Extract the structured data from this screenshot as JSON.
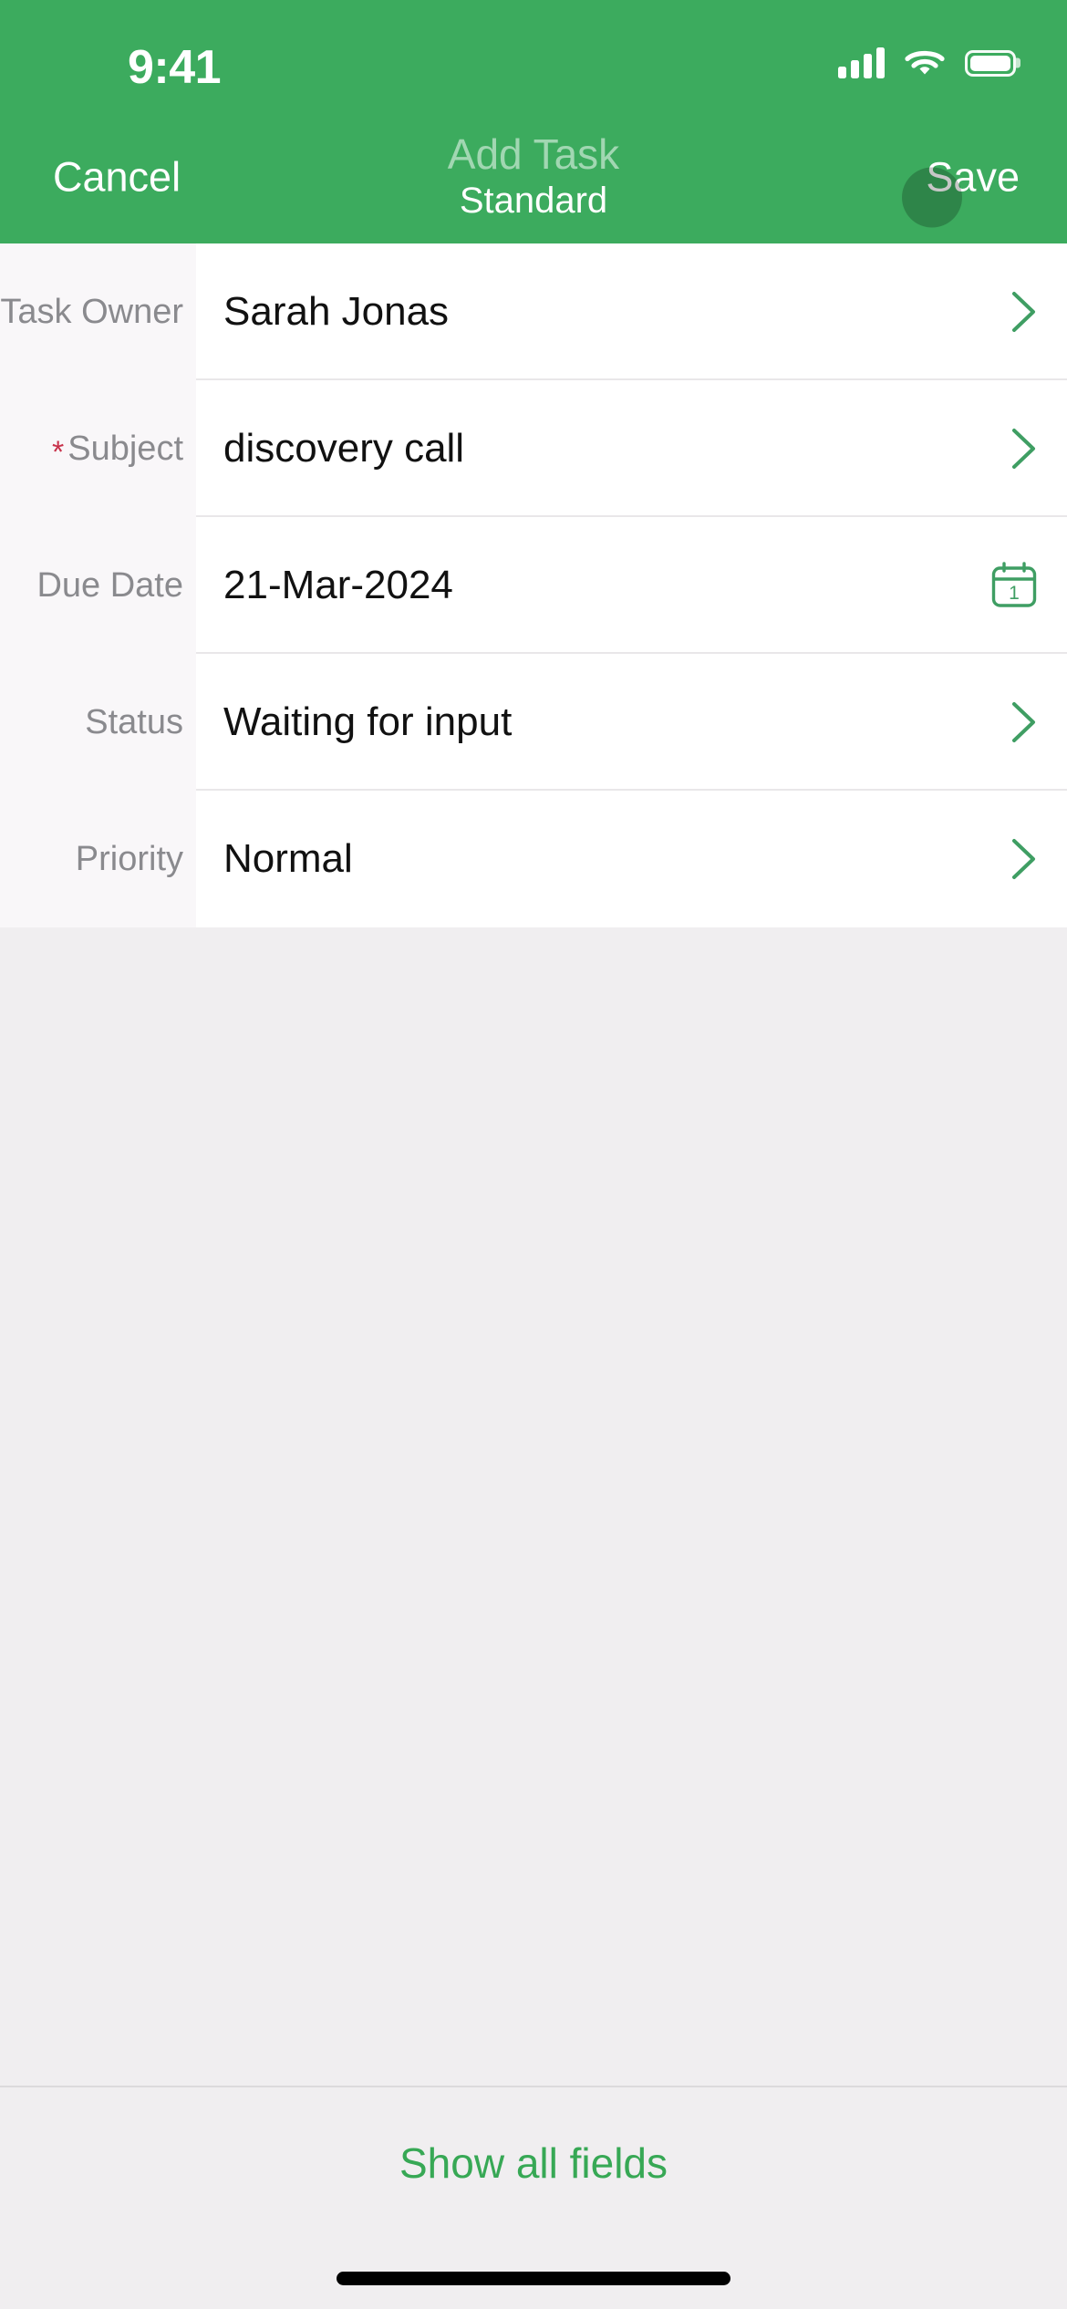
{
  "status_bar": {
    "time": "9:41",
    "signal_icon": "signal-bars-icon",
    "wifi_icon": "wifi-icon",
    "battery_icon": "battery-icon"
  },
  "nav": {
    "cancel_label": "Cancel",
    "title": "Add Task",
    "subtitle": "Standard",
    "save_label": "Save"
  },
  "form": {
    "rows": [
      {
        "label": "Task Owner",
        "value": "Sarah Jonas",
        "required": false,
        "accessory": "chevron-right-icon"
      },
      {
        "label": "Subject",
        "value": "discovery call",
        "required": true,
        "required_marker": "*",
        "accessory": "chevron-right-icon"
      },
      {
        "label": "Due Date",
        "value": "21-Mar-2024",
        "required": false,
        "accessory": "calendar-icon",
        "calendar_day": "1"
      },
      {
        "label": "Status",
        "value": "Waiting for input",
        "required": false,
        "accessory": "chevron-right-icon"
      },
      {
        "label": "Priority",
        "value": "Normal",
        "required": false,
        "accessory": "chevron-right-icon"
      }
    ]
  },
  "footer": {
    "show_all_label": "Show all fields"
  },
  "colors": {
    "header_green": "#3CAB5E",
    "accent_green": "#37A855",
    "body_grey": "#F0EEF0",
    "label_cell_bg": "#F9F7F9",
    "required_red": "#C8324B",
    "label_grey": "#8A8A8E",
    "value_black": "#111111",
    "divider": "#E9E7E9"
  }
}
